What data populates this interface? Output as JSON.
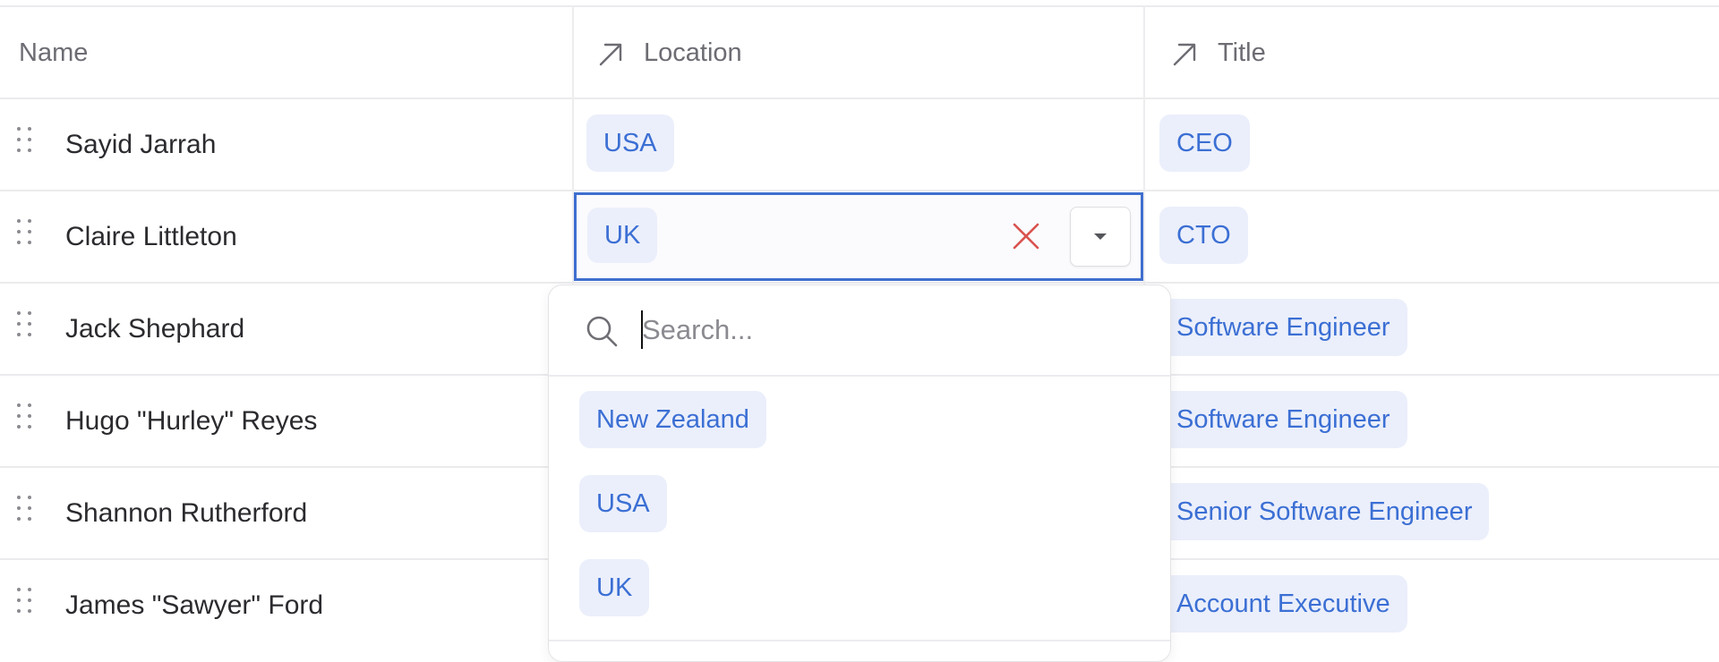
{
  "table": {
    "columns": [
      {
        "label": "Name",
        "icon": null
      },
      {
        "label": "Location",
        "icon": "arrow-up-right-icon"
      },
      {
        "label": "Title",
        "icon": "arrow-up-right-icon"
      }
    ],
    "rows": [
      {
        "name": "Sayid Jarrah",
        "location": "USA",
        "title": "CEO"
      },
      {
        "name": "Claire Littleton",
        "location": "UK",
        "title": "CTO"
      },
      {
        "name": "Jack Shephard",
        "location": "",
        "title": "Software Engineer"
      },
      {
        "name": "Hugo \"Hurley\" Reyes",
        "location": "",
        "title": "Software Engineer"
      },
      {
        "name": "Shannon Rutherford",
        "location": "",
        "title": "Senior Software Engineer"
      },
      {
        "name": "James \"Sawyer\" Ford",
        "location": "",
        "title": "Account Executive"
      }
    ]
  },
  "editor": {
    "row_index": 1,
    "selected_value": "UK",
    "clear_icon": "close-icon",
    "dropdown_icon": "caret-down-icon"
  },
  "popover": {
    "search_placeholder": "Search...",
    "search_value": "",
    "search_icon": "search-icon",
    "options": [
      "New Zealand",
      "USA",
      "UK"
    ]
  },
  "colors": {
    "pill_bg": "#ebeffb",
    "pill_text": "#3b6fd4",
    "focus_border": "#3f6fcf",
    "clear_icon": "#d9534f"
  }
}
